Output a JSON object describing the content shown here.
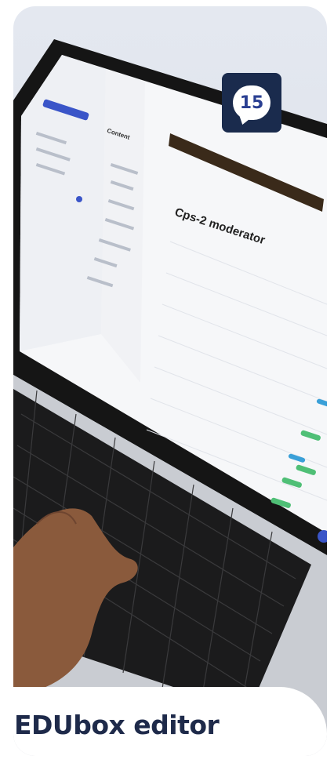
{
  "badge": {
    "number": "15"
  },
  "caption": "EDUbox editor",
  "screen": {
    "heading": "Cps-2 moderator",
    "sidebar_heading": "Content"
  }
}
